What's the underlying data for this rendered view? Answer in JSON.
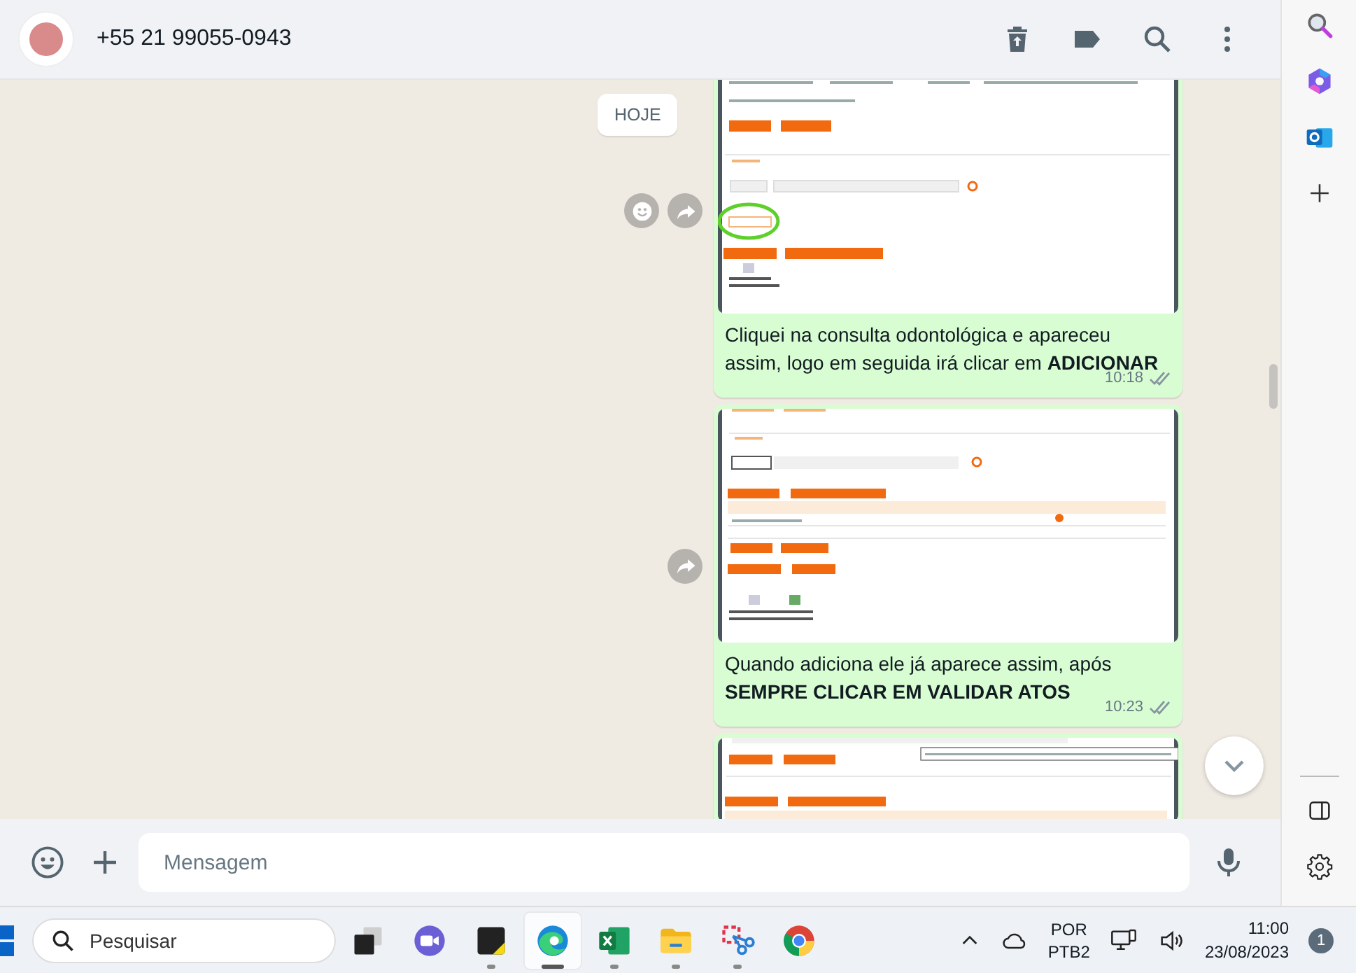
{
  "chat_header": {
    "contact": "+55 21 99055-0943"
  },
  "date_chip": "HOJE",
  "messages": [
    {
      "kind": "image_caption",
      "text": "Cliquei na consulta odontológica e apareceu assim, logo em seguida irá clicar em **ADICIONAR**",
      "time": "10:18",
      "read": false,
      "show_react": true,
      "show_forward": true
    },
    {
      "kind": "image_caption",
      "text": "Quando adiciona ele já aparece assim, após **SEMPRE CLICAR EM VALIDAR ATOS**",
      "time": "10:23",
      "read": false,
      "show_react": false,
      "show_forward": true
    },
    {
      "kind": "image",
      "show_react": false,
      "show_forward": false
    }
  ],
  "composer": {
    "placeholder": "Mensagem"
  },
  "taskbar": {
    "search_placeholder": "Pesquisar",
    "apps": [
      {
        "kind": "taskview",
        "running": false,
        "active": false
      },
      {
        "kind": "meet",
        "running": false,
        "active": false
      },
      {
        "kind": "sticky",
        "running": true,
        "active": false
      },
      {
        "kind": "edge",
        "running": true,
        "active": true
      },
      {
        "kind": "excel",
        "running": true,
        "active": false
      },
      {
        "kind": "files",
        "running": true,
        "active": false
      },
      {
        "kind": "snip",
        "running": true,
        "active": false
      },
      {
        "kind": "chrome",
        "running": false,
        "active": false
      }
    ],
    "language": "POR",
    "layout": "PTB2",
    "time": "11:00",
    "date": "23/08/2023",
    "notifications": "1"
  }
}
